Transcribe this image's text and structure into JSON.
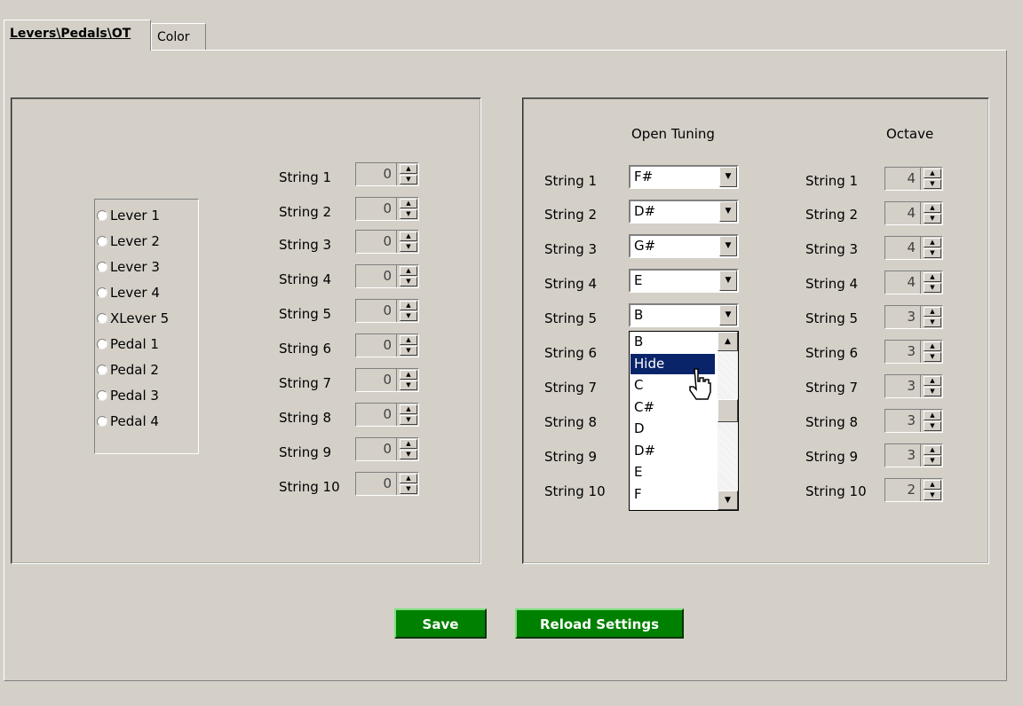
{
  "tabs": [
    "Levers\\Pedals\\OT",
    "Color"
  ],
  "levers": [
    "Lever 1",
    "Lever 2",
    "Lever 3",
    "Lever 4",
    "XLever 5",
    "Pedal 1",
    "Pedal 2",
    "Pedal 3",
    "Pedal 4"
  ],
  "left_strings": [
    {
      "label": "String 1",
      "value": "0"
    },
    {
      "label": "String 2",
      "value": "0"
    },
    {
      "label": "String 3",
      "value": "0"
    },
    {
      "label": "String 4",
      "value": "0"
    },
    {
      "label": "String 5",
      "value": "0"
    },
    {
      "label": "String 6",
      "value": "0"
    },
    {
      "label": "String 7",
      "value": "0"
    },
    {
      "label": "String 8",
      "value": "0"
    },
    {
      "label": "String 9",
      "value": "0"
    },
    {
      "label": "String 10",
      "value": "0"
    }
  ],
  "open_tuning": {
    "header": "Open Tuning",
    "labels": [
      "String 1",
      "String 2",
      "String 3",
      "String 4",
      "String 5",
      "String 6",
      "String 7",
      "String 8",
      "String 9",
      "String 10"
    ],
    "combos": [
      "F#",
      "D#",
      "G#",
      "E",
      "B"
    ],
    "dropdown_items": [
      "B",
      "Hide",
      "C",
      "C#",
      "D",
      "D#",
      "E",
      "F"
    ],
    "dropdown_selected": "Hide"
  },
  "octave": {
    "header": "Octave",
    "rows": [
      {
        "label": "String 1",
        "value": "4"
      },
      {
        "label": "String 2",
        "value": "4"
      },
      {
        "label": "String 3",
        "value": "4"
      },
      {
        "label": "String 4",
        "value": "4"
      },
      {
        "label": "String 5",
        "value": "3"
      },
      {
        "label": "String 6",
        "value": "3"
      },
      {
        "label": "String 7",
        "value": "3"
      },
      {
        "label": "String 8",
        "value": "3"
      },
      {
        "label": "String 9",
        "value": "3"
      },
      {
        "label": "String 10",
        "value": "2"
      }
    ]
  },
  "buttons": {
    "save": "Save",
    "reload": "Reload Settings"
  }
}
